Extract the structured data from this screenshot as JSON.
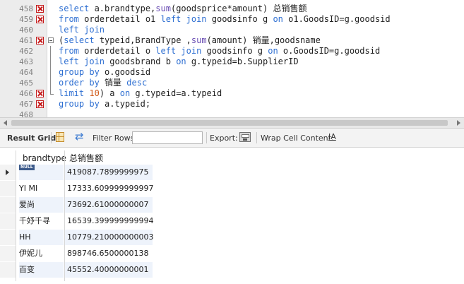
{
  "editor": {
    "lines": [
      {
        "num": "458",
        "error": true,
        "fold": "none",
        "tokens": [
          [
            "kw",
            "select"
          ],
          [
            "id",
            " a.brandtype,"
          ],
          [
            "fn",
            "sum"
          ],
          [
            "id",
            "(goodsprice*amount) "
          ],
          [
            "cn",
            "总销售额"
          ]
        ]
      },
      {
        "num": "459",
        "error": true,
        "fold": "none",
        "tokens": [
          [
            "kw",
            "from"
          ],
          [
            "id",
            " orderdetail o1 "
          ],
          [
            "kw",
            "left join"
          ],
          [
            "id",
            " goodsinfo g "
          ],
          [
            "kw",
            "on"
          ],
          [
            "id",
            " o1.GoodsID=g.goodsid"
          ]
        ]
      },
      {
        "num": "460",
        "error": false,
        "fold": "none",
        "tokens": [
          [
            "kw",
            "left join"
          ]
        ]
      },
      {
        "num": "461",
        "error": true,
        "fold": "start",
        "tokens": [
          [
            "id",
            "("
          ],
          [
            "kw",
            "select"
          ],
          [
            "id",
            " typeid,BrandType ,"
          ],
          [
            "fn",
            "sum"
          ],
          [
            "id",
            "(amount) "
          ],
          [
            "cn",
            "销量"
          ],
          [
            "id",
            ",goodsname"
          ]
        ]
      },
      {
        "num": "462",
        "error": false,
        "fold": "mid",
        "tokens": [
          [
            "kw",
            "from"
          ],
          [
            "id",
            " orderdetail o "
          ],
          [
            "kw",
            "left join"
          ],
          [
            "id",
            " goodsinfo g "
          ],
          [
            "kw",
            "on"
          ],
          [
            "id",
            " o.GoodsID=g.goodsid"
          ]
        ]
      },
      {
        "num": "463",
        "error": false,
        "fold": "mid",
        "tokens": [
          [
            "kw",
            "left join"
          ],
          [
            "id",
            " goodsbrand b "
          ],
          [
            "kw",
            "on"
          ],
          [
            "id",
            " g.typeid=b.SupplierID"
          ]
        ]
      },
      {
        "num": "464",
        "error": false,
        "fold": "mid",
        "tokens": [
          [
            "kw",
            "group by"
          ],
          [
            "id",
            " o.goodsid"
          ]
        ]
      },
      {
        "num": "465",
        "error": false,
        "fold": "mid",
        "tokens": [
          [
            "kw",
            "order by"
          ],
          [
            "id",
            " "
          ],
          [
            "cn",
            "销量"
          ],
          [
            "id",
            " "
          ],
          [
            "kw",
            "desc"
          ]
        ]
      },
      {
        "num": "466",
        "error": true,
        "fold": "end",
        "tokens": [
          [
            "kw",
            "limit"
          ],
          [
            "id",
            " "
          ],
          [
            "num",
            "10"
          ],
          [
            "id",
            ") a "
          ],
          [
            "kw",
            "on"
          ],
          [
            "id",
            " g.typeid=a.typeid"
          ]
        ]
      },
      {
        "num": "467",
        "error": true,
        "fold": "none",
        "tokens": [
          [
            "kw",
            "group by"
          ],
          [
            "id",
            " a.typeid;"
          ]
        ]
      },
      {
        "num": "468",
        "error": false,
        "fold": "none",
        "tokens": []
      }
    ]
  },
  "toolbar": {
    "result_grid_label": "Result Grid",
    "filter_label": "Filter Rows:",
    "filter_value": "",
    "export_label": "Export:",
    "wrap_label": "Wrap Cell Content:",
    "wrap_icon": "IA"
  },
  "grid": {
    "columns": [
      "brandtype",
      "总销售额"
    ],
    "null_label": "NULL",
    "rows": [
      {
        "brandtype": null,
        "total": "419087.7899999975",
        "current": true
      },
      {
        "brandtype": "YI MI",
        "total": "17333.609999999997"
      },
      {
        "brandtype": "爱尚",
        "total": "73692.61000000007"
      },
      {
        "brandtype": "千妤千寻",
        "total": "16539.399999999994"
      },
      {
        "brandtype": "HH",
        "total": "10779.210000000003"
      },
      {
        "brandtype": "伊妮儿",
        "total": "898746.6500000138"
      },
      {
        "brandtype": "百变",
        "total": "45552.40000000001"
      }
    ]
  },
  "colors": {
    "keyword": "#2e6fd2",
    "function": "#6b4fb4",
    "number": "#d15b1a",
    "error": "#c41a1a",
    "null_badge": "#3d5b8b",
    "alt_row": "#eef3fb"
  }
}
